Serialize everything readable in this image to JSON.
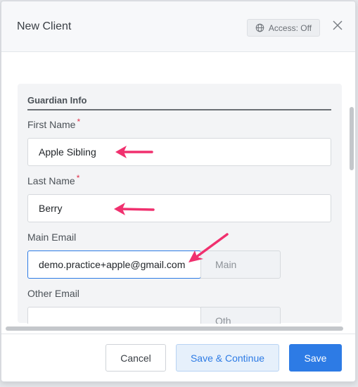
{
  "dialog": {
    "title": "New Client",
    "access_label": "Access: Off",
    "close_icon": "close-icon",
    "access_icon": "globe-icon"
  },
  "section": {
    "title": "Guardian Info",
    "fields": {
      "first_name": {
        "label": "First Name",
        "required_mark": "*",
        "value": "Apple Sibling"
      },
      "last_name": {
        "label": "Last Name",
        "required_mark": "*",
        "value": "Berry"
      },
      "main_email": {
        "label": "Main Email",
        "value": "demo.practice+apple@gmail.com",
        "type_label": "Main"
      },
      "other_email": {
        "label": "Other Email",
        "value": "",
        "type_label": "Oth"
      }
    }
  },
  "footer": {
    "cancel_label": "Cancel",
    "save_continue_label": "Save & Continue",
    "save_label": "Save"
  },
  "colors": {
    "accent": "#2d7be5",
    "annotation_arrow": "#f0306e",
    "required": "#e0304a"
  }
}
